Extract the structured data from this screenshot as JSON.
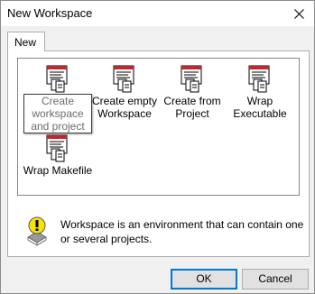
{
  "window": {
    "title": "New Workspace"
  },
  "tabs": [
    {
      "label": "New"
    }
  ],
  "items": [
    {
      "label": "Create workspace and project",
      "icon": "project-document-icon",
      "selected": true
    },
    {
      "label": "Create empty Workspace",
      "icon": "project-document-icon",
      "selected": false
    },
    {
      "label": "Create from Project",
      "icon": "project-document-icon",
      "selected": false
    },
    {
      "label": "Wrap Executable",
      "icon": "project-document-icon",
      "selected": false
    },
    {
      "label": "Wrap Makefile",
      "icon": "project-document-icon",
      "selected": false
    }
  ],
  "info": {
    "icon": "lightbulb-info-icon",
    "text": "Workspace is an environment that can contain one or several projects."
  },
  "buttons": {
    "ok": "OK",
    "cancel": "Cancel"
  },
  "colors": {
    "accent": "#0078d7",
    "icon_red": "#c0282d",
    "icon_yellow": "#f6e400"
  }
}
